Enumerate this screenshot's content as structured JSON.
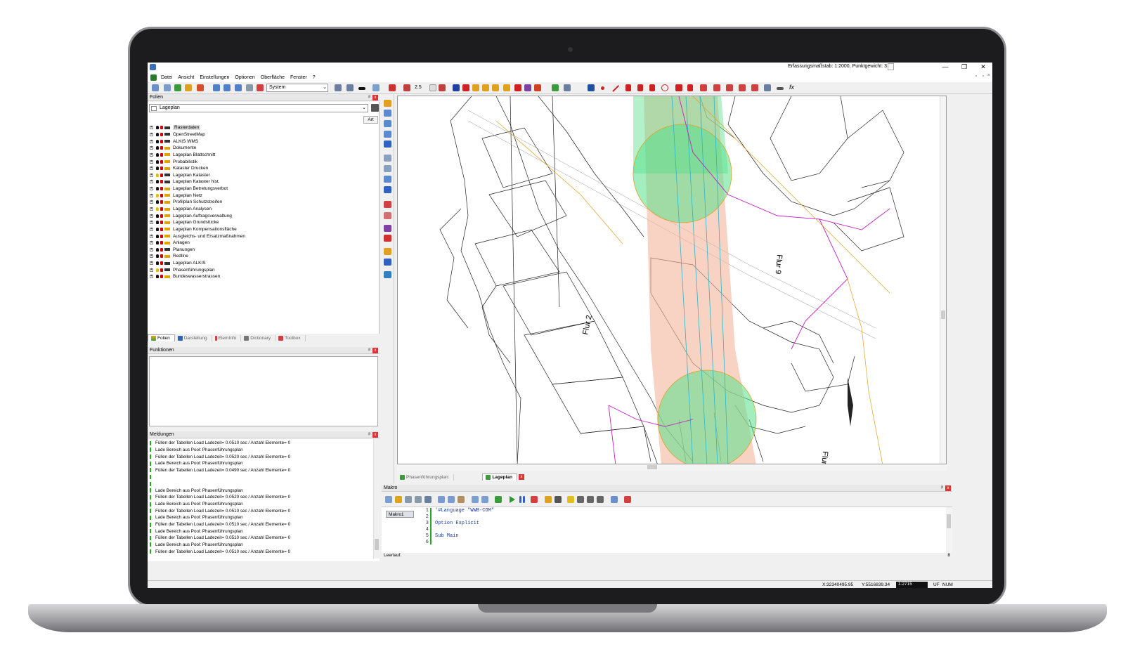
{
  "window": {
    "scale_info": "Erfassungsmaßstab: 1:2000, Punktgewicht: 3",
    "minimize": "—",
    "restore": "❐",
    "close": "✕"
  },
  "menu": [
    "Datei",
    "Ansicht",
    "Einstellungen",
    "Optionen",
    "Oberfläche",
    "Fenster",
    "?"
  ],
  "toolbar": {
    "system_combo": "System",
    "width_value": "2.5",
    "fx_label": "fx"
  },
  "folien": {
    "title": "Folien",
    "combo_value": "Lageplan",
    "art_button": "Art",
    "layers": [
      {
        "name": "Rasterdaten",
        "bulb": "#111",
        "extra": "#333"
      },
      {
        "name": "OpenStreetMap",
        "bulb": "#111",
        "extra": "#333"
      },
      {
        "name": "ALKIS WMS",
        "bulb": "#111",
        "extra": "#333"
      },
      {
        "name": "Dokumente",
        "bulb": "#111",
        "extra": "#e6a000"
      },
      {
        "name": "Lageplan Blattschnitt",
        "bulb": "#111",
        "extra": "#e6a000"
      },
      {
        "name": "Probabilistik",
        "bulb": "#111",
        "extra": "#e6a000"
      },
      {
        "name": "Kataster Drucken",
        "bulb": "#111",
        "extra": "#e6a000"
      },
      {
        "name": "Lageplan Kataster",
        "bulb": "#e0c000",
        "extra": "#333"
      },
      {
        "name": "Lageplan Kataster hist.",
        "bulb": "#111",
        "extra": "#333"
      },
      {
        "name": "Lageplan Betretungsverbot",
        "bulb": "#111",
        "extra": "#e6a000"
      },
      {
        "name": "Lageplan Netz",
        "bulb": "#e0c000",
        "extra": "#e6a000"
      },
      {
        "name": "Profilplan Schutzstreifen",
        "bulb": "#111",
        "extra": "#e6a000"
      },
      {
        "name": "Lageplan Analysen",
        "bulb": "#e0c000",
        "extra": "#e6a000"
      },
      {
        "name": "Lageplan Auftragsverwaltung",
        "bulb": "#111",
        "extra": "#e6a000"
      },
      {
        "name": "Lageplan Grundstücke",
        "bulb": "#111",
        "extra": "#e6a000"
      },
      {
        "name": "Lageplan Kompensationsfläche",
        "bulb": "#111",
        "extra": "#e6a000"
      },
      {
        "name": "Ausgleichs- und Ersatzmaßnahmen",
        "bulb": "#111",
        "extra": "#e6a000"
      },
      {
        "name": "Anlagen",
        "bulb": "#111",
        "extra": "#e6a000"
      },
      {
        "name": "Planungen",
        "bulb": "#111",
        "extra": "#333"
      },
      {
        "name": "Redline",
        "bulb": "#111",
        "extra": "#e6a000"
      },
      {
        "name": "Lageplan ALKIS",
        "bulb": "#111",
        "extra": "#333"
      },
      {
        "name": "Phasenführungsplan",
        "bulb": "#e0c000",
        "extra": "#333"
      },
      {
        "name": "Bundeswasserstrassen",
        "bulb": "#111",
        "extra": "#e6a000"
      }
    ],
    "tabs": [
      "Folien",
      "Darstellung",
      "ElemInfo",
      "Dictionary",
      "Toolbox"
    ]
  },
  "funktionen": {
    "title": "Funktionen"
  },
  "meldungen": {
    "title": "Meldungen",
    "messages": [
      "Füllen der Tabellen Load Ladezeit= 0.0510 sec  / Anzahl Elemente= 0",
      "Lade Bereich aus Pool: Phasenführungsplan",
      "Füllen der Tabellen Load Ladezeit= 0.0520 sec  / Anzahl Elemente= 0",
      "Lade Bereich aus Pool: Phasenführungsplan",
      "Füllen der Tabellen Load Ladezeit= 0.0490 sec  / Anzahl Elemente= 0",
      "",
      "",
      "Lade Bereich aus Pool: Phasenführungsplan",
      "Füllen der Tabellen Load Ladezeit= 0.0520 sec  / Anzahl Elemente= 0",
      "Lade Bereich aus Pool: Phasenführungsplan",
      "Füllen der Tabellen Load Ladezeit= 0.0510 sec  / Anzahl Elemente= 0",
      "Lade Bereich aus Pool: Phasenführungsplan",
      "Füllen der Tabellen Load Ladezeit= 0.0510 sec  / Anzahl Elemente= 0",
      "Lade Bereich aus Pool: Phasenführungsplan",
      "Füllen der Tabellen Load Ladezeit= 0.0510 sec  / Anzahl Elemente= 0",
      "Lade Bereich aus Pool: Phasenführungsplan",
      "Füllen der Tabellen Load Ladezeit= 0.0510 sec  / Anzahl Elemente= 0"
    ]
  },
  "map": {
    "labels": {
      "flur2": "Flur 2",
      "flur9": "Flur 9",
      "flur_bottom": "Flur"
    },
    "tabs": [
      "Phasenführungsplan:",
      "Lageplan"
    ]
  },
  "makro": {
    "title": "Makro",
    "tab": "Makro1",
    "line_numbers": [
      "1",
      "2",
      "3",
      "4",
      "5",
      "6"
    ],
    "code_lines": [
      "'#Language \"WWB-COM\"",
      "",
      "Option Explicit",
      "",
      "Sub Main",
      ""
    ],
    "status": "Leerlauf.",
    "status_right": "8"
  },
  "statusbar": {
    "x": "X:32340495.95",
    "y": "Y:5516839.34",
    "scale": "1:2715",
    "uf": "UF",
    "num": "NUM"
  }
}
